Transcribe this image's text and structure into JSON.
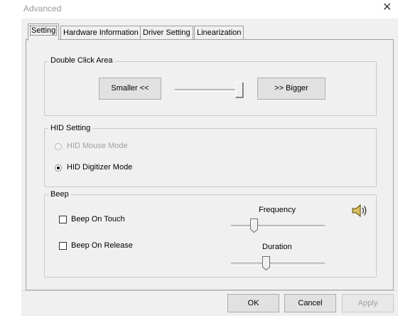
{
  "window": {
    "title": "Advanced"
  },
  "tabs": [
    {
      "label": "Setting"
    },
    {
      "label": "Hardware Information"
    },
    {
      "label": "Driver Setting"
    },
    {
      "label": "Linearization"
    }
  ],
  "double_click": {
    "group_title": "Double Click Area",
    "smaller_label": "Smaller <<",
    "bigger_label": ">> Bigger"
  },
  "hid": {
    "group_title": "HID Setting",
    "mouse_mode_label": "HID Mouse Mode",
    "digitizer_mode_label": "HID Digitizer Mode"
  },
  "beep": {
    "group_title": "Beep",
    "on_touch_label": "Beep On Touch",
    "on_release_label": "Beep On Release",
    "frequency_label": "Frequency",
    "duration_label": "Duration"
  },
  "footer": {
    "ok_label": "OK",
    "cancel_label": "Cancel",
    "apply_label": "Apply"
  }
}
